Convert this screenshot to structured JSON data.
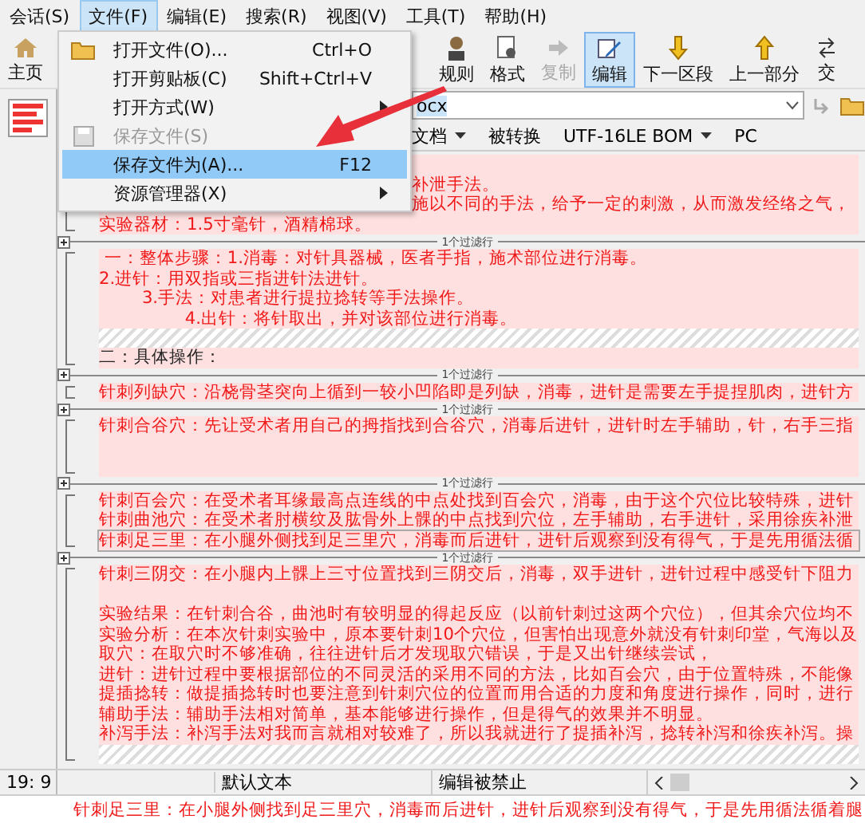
{
  "menubar": [
    {
      "label": "会话(S)",
      "selected": false
    },
    {
      "label": "文件(F)",
      "selected": true
    },
    {
      "label": "编辑(E)",
      "selected": false
    },
    {
      "label": "搜索(R)",
      "selected": false
    },
    {
      "label": "视图(V)",
      "selected": false
    },
    {
      "label": "工具(T)",
      "selected": false
    },
    {
      "label": "帮助(H)",
      "selected": false
    }
  ],
  "toolbar": [
    {
      "label": "主页",
      "kind": "home",
      "disabled": false,
      "selected": false
    },
    {
      "kind": "gap"
    },
    {
      "label": "规则",
      "kind": "rules",
      "disabled": false,
      "selected": false
    },
    {
      "label": "格式",
      "kind": "format",
      "disabled": false,
      "selected": false
    },
    {
      "label": "复制",
      "kind": "copy",
      "disabled": true,
      "selected": false
    },
    {
      "label": "编辑",
      "kind": "edit",
      "disabled": false,
      "selected": true
    },
    {
      "label": "下一区段",
      "kind": "down",
      "disabled": false,
      "selected": false
    },
    {
      "label": "上一部分",
      "kind": "up",
      "disabled": false,
      "selected": false
    },
    {
      "label": "交",
      "kind": "swap",
      "disabled": false,
      "selected": false
    }
  ],
  "path": {
    "value": "ocx"
  },
  "info": [
    {
      "label": "文档",
      "dropdown": true
    },
    {
      "label": "被转换",
      "dropdown": false
    },
    {
      "label": "UTF-16LE BOM",
      "dropdown": true
    },
    {
      "label": "PC",
      "dropdown": false
    }
  ],
  "file_menu": [
    {
      "label": "打开文件(O)...",
      "shortcut": "Ctrl+O",
      "icon": true,
      "submenu": false,
      "disabled": false,
      "selected": false
    },
    {
      "label": "打开剪贴板(C)",
      "shortcut": "Shift+Ctrl+V",
      "icon": false,
      "submenu": false,
      "disabled": false,
      "selected": false
    },
    {
      "label": "打开方式(W)",
      "icon": false,
      "submenu": true,
      "disabled": false,
      "selected": false
    },
    {
      "label": "保存文件(S)",
      "icon": true,
      "submenu": false,
      "disabled": true,
      "selected": false
    },
    {
      "label": "保存文件为(A)...",
      "shortcut": "F12",
      "icon": false,
      "submenu": false,
      "disabled": false,
      "selected": true
    },
    {
      "label": "资源管理器(X)",
      "icon": false,
      "submenu": true,
      "disabled": false,
      "selected": false
    }
  ],
  "editor": [
    {
      "kind": "lines",
      "rows": [
        {
          "kind": "blank"
        },
        {
          "text": "补泄手法。",
          "covered": true
        },
        {
          "text": "施以不同的手法，给予一定的刺激，从而激发经络之气，",
          "covered": true
        },
        {
          "text": "实验器材：1.5寸毫针，酒精棉球。"
        }
      ]
    },
    {
      "kind": "separator",
      "label": "1个过滤行"
    },
    {
      "kind": "lines",
      "rows": [
        {
          "text": " 一：整体步骤：1.消毒：对针具器械，医者手指，施术部位进行消毒。"
        },
        {
          "text": "2.进针：用双指或三指进针法进针。"
        },
        {
          "text": "        3.手法：对患者进行提拉捻转等手法操作。"
        },
        {
          "text": "                4.出针：将针取出，并对该部位进行消毒。"
        },
        {
          "kind": "hatch"
        },
        {
          "text": "二：具体操作：",
          "kind": "plain"
        }
      ]
    },
    {
      "kind": "separator",
      "label": "1个过滤行"
    },
    {
      "kind": "lines",
      "rows": [
        {
          "text": "针刺列缺穴：沿桡骨茎突向上循到一较小凹陷即是列缺，消毒，进针是需要左手提捏肌肉，进针方"
        }
      ]
    },
    {
      "kind": "separator",
      "label": "1个过滤行"
    },
    {
      "kind": "lines",
      "rows": [
        {
          "text": "针刺合谷穴：先让受术者用自己的拇指找到合谷穴，消毒后进针，进针时左手辅助，针，右手三指"
        },
        {
          "kind": "blank"
        },
        {
          "kind": "blank"
        }
      ]
    },
    {
      "kind": "separator",
      "label": "1个过滤行"
    },
    {
      "kind": "lines",
      "rows": [
        {
          "text": "针刺百会穴：在受术者耳缘最高点连线的中点处找到百会穴，消毒，由于这个穴位比较特殊，进针"
        },
        {
          "text": "针刺曲池穴：在受术者肘横纹及肱骨外上髁的中点找到穴位，左手辅助，右手进针，采用徐疾补泄"
        },
        {
          "text": "针刺足三里：在小腿外侧找到足三里穴，消毒而后进针，进针后观察到没有得气，于是先用循法循",
          "current": true
        }
      ]
    },
    {
      "kind": "separator",
      "label": "1个过滤行"
    },
    {
      "kind": "lines",
      "rows": [
        {
          "text": "针刺三阴交：在小腿内上髁上三寸位置找到三阴交后，消毒，双手进针，进针过程中感受针下阻力"
        },
        {
          "kind": "blank"
        },
        {
          "text": "实验结果：在针刺合谷，曲池时有较明显的得起反应（以前针刺过这两个穴位），但其余穴位均不"
        },
        {
          "text": "实验分析：在本次针刺实验中，原本要针刺10个穴位，但害怕出现意外就没有针刺印堂，气海以及"
        },
        {
          "text": "取穴：在取穴时不够准确，往往进针后才发现取穴错误，于是又出针继续尝试，"
        },
        {
          "text": "进针：进针过程中要根据部位的不同灵活的采用不同的方法，比如百会穴，由于位置特殊，不能像"
        },
        {
          "text": "提插捻转：做提插捻转时也要注意到针刺穴位的位置而用合适的力度和角度进行操作，同时，进行"
        },
        {
          "text": "辅助手法：辅助手法相对简单，基本能够进行操作，但是得气的效果并不明显。"
        },
        {
          "text": "补泻手法：补泻手法对我而言就相对较难了，所以我就进行了提插补泻，捻转补泻和徐疾补泻。操"
        },
        {
          "kind": "hatch"
        }
      ]
    }
  ],
  "status_bar": {
    "position": "19: 9",
    "format": "默认文本",
    "mode": "编辑被禁止"
  },
  "preview": {
    "text": "针刺足三里：在小腿外侧找到足三里穴，消毒而后进针，进针后观察到没有得气，于是先用循法循着腿"
  }
}
